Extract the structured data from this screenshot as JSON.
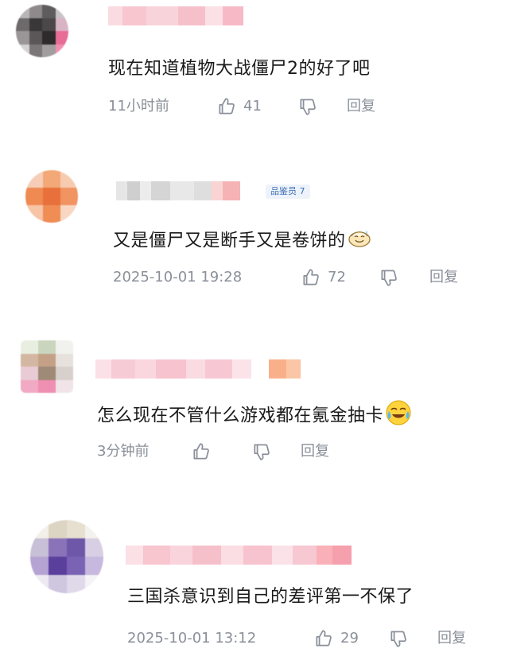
{
  "comments": [
    {
      "text": "现在知道植物大战僵尸2的好了吧",
      "time": "11小时前",
      "likes": "41",
      "reply_label": "回复"
    },
    {
      "badge": "品鉴员 7",
      "text": "又是僵尸又是断手又是卷饼的",
      "emoji": "grin-sweat-emoji",
      "time": "2025-10-01 19:28",
      "likes": "72",
      "reply_label": "回复"
    },
    {
      "text": "怎么现在不管什么游戏都在氪金抽卡",
      "emoji": "crying-laughing-emoji",
      "time": "3分钟前",
      "likes": "",
      "reply_label": "回复"
    },
    {
      "text": "三国杀意识到自己的差评第一不保了",
      "time": "2025-10-01 13:12",
      "likes": "29",
      "reply_label": "回复"
    }
  ],
  "colors": {
    "text": "#1a1a1a",
    "meta": "#8a8f99",
    "badge_text": "#3d6fb5",
    "name_blur_pink": "#f7c6cf",
    "name_blur_orange": "#f9b08a"
  },
  "icons": {
    "like": "thumbs-up-icon",
    "dislike": "thumbs-down-icon"
  }
}
